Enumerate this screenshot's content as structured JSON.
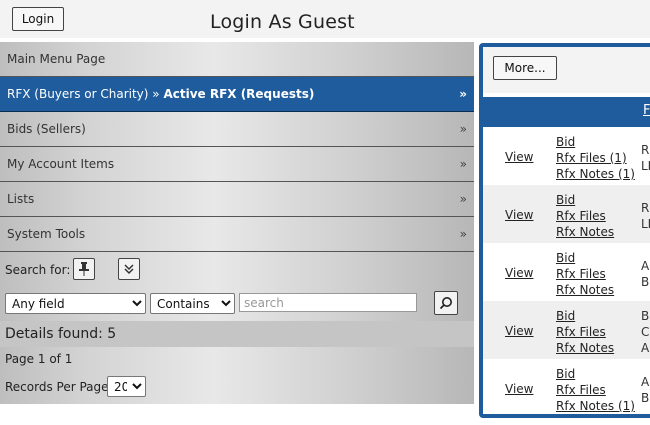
{
  "header": {
    "login_label": "Login",
    "title": "Login As Guest"
  },
  "menu": {
    "main": "Main Menu Page",
    "rfx_prefix": "RFX (Buyers or Charity) » ",
    "rfx_current": "Active RFX (Requests)",
    "bids": "Bids (Sellers)",
    "account": "My Account Items",
    "lists": "Lists",
    "system": "System Tools",
    "chevron": "»"
  },
  "search": {
    "label": "Search for:",
    "field_selected": "Any field",
    "op_selected": "Contains",
    "placeholder": "search",
    "pin_icon": "pin-icon",
    "expand_icon": "double-chevron-down-icon",
    "search_icon": "magnifier-icon"
  },
  "results": {
    "details": "Details found: 5",
    "page": "Page 1 of 1",
    "rpp_label": "Records Per Page:",
    "rpp_value": "20"
  },
  "panel": {
    "more_label": "More...",
    "header_partial": "F",
    "rows": [
      {
        "view": "View",
        "bid": "Bid",
        "files": "Rfx Files (1)",
        "notes": "Rfx Notes (1)",
        "t1": "R",
        "t2": "LL"
      },
      {
        "view": "View",
        "bid": "Bid",
        "files": "Rfx Files",
        "notes": "Rfx Notes",
        "t1": "R",
        "t2": "LL"
      },
      {
        "view": "View",
        "bid": "Bid",
        "files": "Rfx Files",
        "notes": "Rfx Notes",
        "t1": "A",
        "t2": "B"
      },
      {
        "view": "View",
        "bid": "Bid",
        "files": "Rfx Files",
        "notes": "Rfx Notes",
        "t1": "B",
        "t2": "C",
        "t3": "Al"
      },
      {
        "view": "View",
        "bid": "Bid",
        "files": "Rfx Files",
        "notes": "Rfx Notes (1)",
        "t1": "A",
        "t2": "B"
      }
    ]
  },
  "colors": {
    "accent": "#1f5c9d",
    "row_alt": "#efefef"
  }
}
